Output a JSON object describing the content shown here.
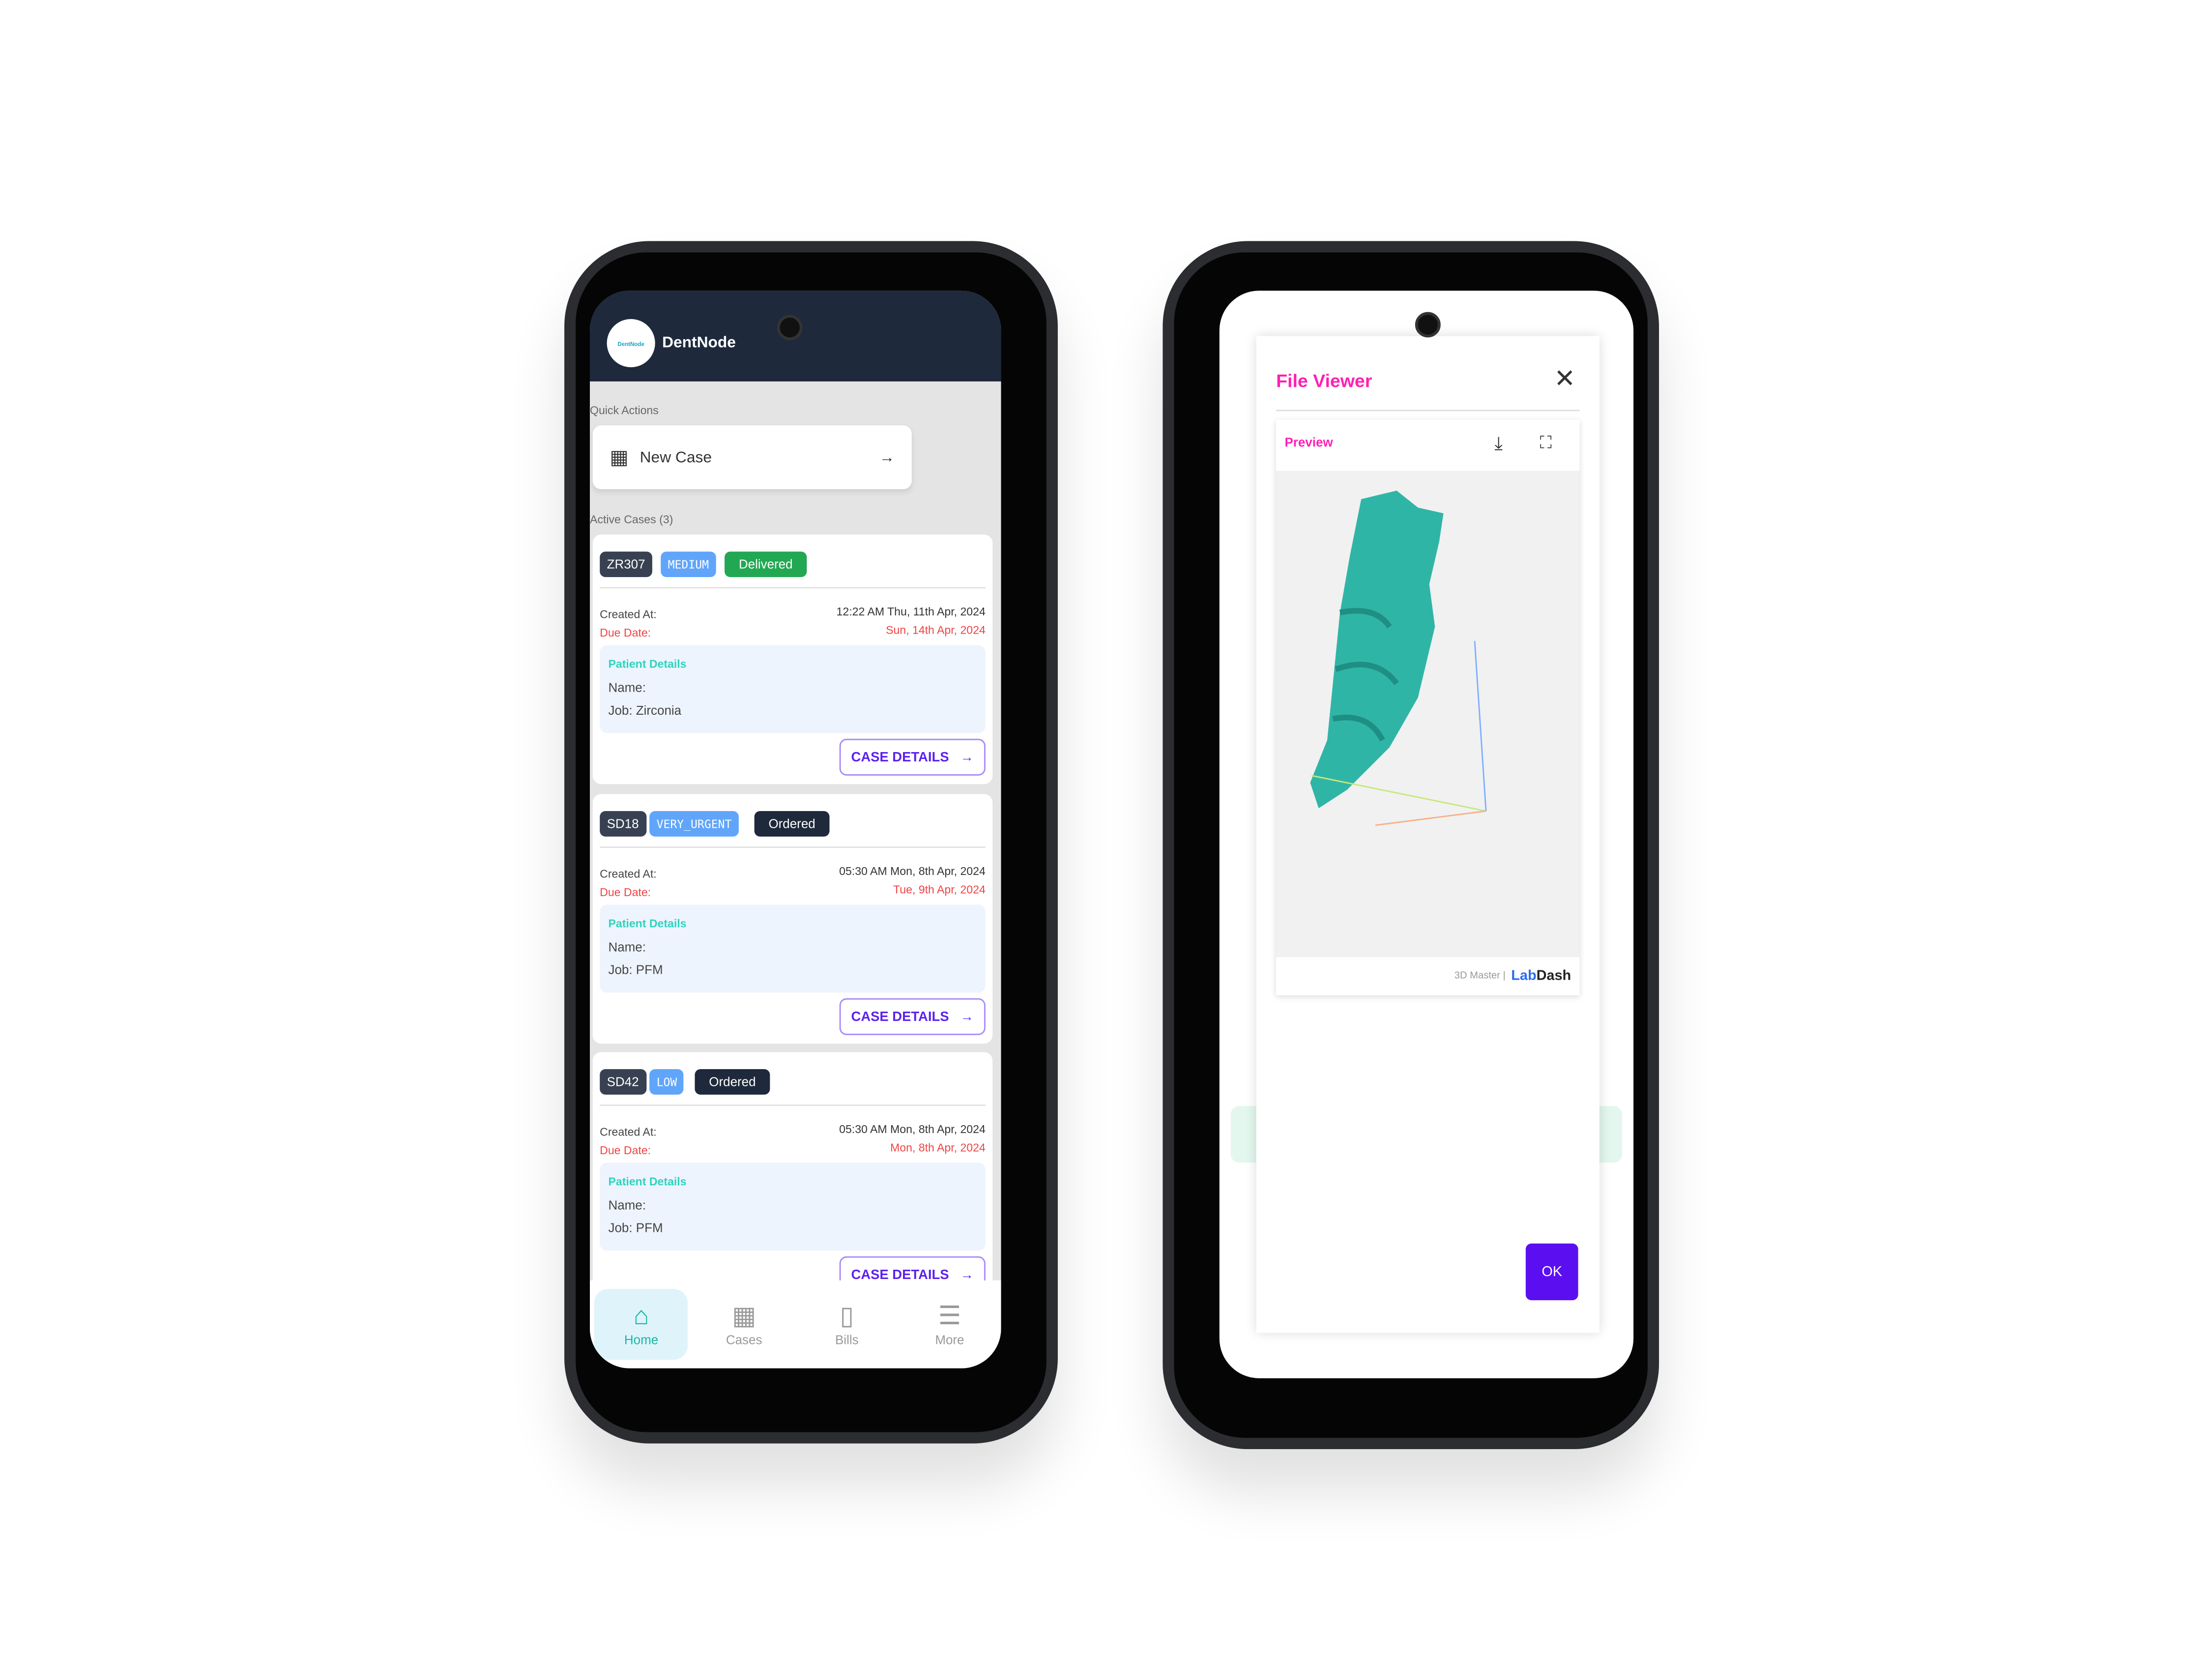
{
  "left_phone": {
    "header": {
      "logo_text": "DentNode",
      "app_name": "DentNode"
    },
    "quick_actions": {
      "title": "Quick Actions",
      "new_case_label": "New Case",
      "new_case_icon": "teeth-icon",
      "arrow_icon": "arrow-right-icon"
    },
    "active_cases": {
      "title": "Active Cases (3)",
      "cases": [
        {
          "id": "ZR307",
          "priority": "MEDIUM",
          "status": "Delivered",
          "status_color": "#22a852",
          "created_label": "Created At:",
          "created_at": "12:22 AM Thu, 11th Apr, 2024",
          "due_label": "Due Date:",
          "due_date": "Sun, 14th Apr, 2024",
          "patient_title": "Patient Details",
          "name": "Name:",
          "job": "Job: Zirconia",
          "button": "CASE DETAILS"
        },
        {
          "id": "SD18",
          "priority": "VERY_URGENT",
          "status": "Ordered",
          "status_color": "#1e293b",
          "created_label": "Created At:",
          "created_at": "05:30 AM Mon, 8th Apr, 2024",
          "due_label": "Due Date:",
          "due_date": "Tue, 9th Apr, 2024",
          "patient_title": "Patient Details",
          "name": "Name:",
          "job": "Job: PFM",
          "button": "CASE DETAILS"
        },
        {
          "id": "SD42",
          "priority": "LOW",
          "status": "Ordered",
          "status_color": "#1e293b",
          "created_label": "Created At:",
          "created_at": "05:30 AM Mon, 8th Apr, 2024",
          "due_label": "Due Date:",
          "due_date": "Mon, 8th Apr, 2024",
          "patient_title": "Patient Details",
          "name": "Name:",
          "job": "Job: PFM",
          "button": "CASE DETAILS"
        }
      ]
    },
    "bottom_nav": [
      {
        "label": "Home",
        "icon": "home-icon",
        "active": true
      },
      {
        "label": "Cases",
        "icon": "teeth-icon"
      },
      {
        "label": "Bills",
        "icon": "file-icon"
      },
      {
        "label": "More",
        "icon": "menu-icon"
      }
    ]
  },
  "right_phone": {
    "dialog": {
      "title": "File Viewer",
      "close_icon": "close-icon",
      "preview_label": "Preview",
      "download_icon": "download-icon",
      "fullscreen_icon": "fullscreen-icon",
      "footer_text": "3D Master |",
      "brand_lab": "Lab",
      "brand_dash": "Dash",
      "ok_label": "OK",
      "accent": "#ff1fb4",
      "ok_color": "#5b0ff0",
      "model_color": "#2fb5a6"
    }
  }
}
